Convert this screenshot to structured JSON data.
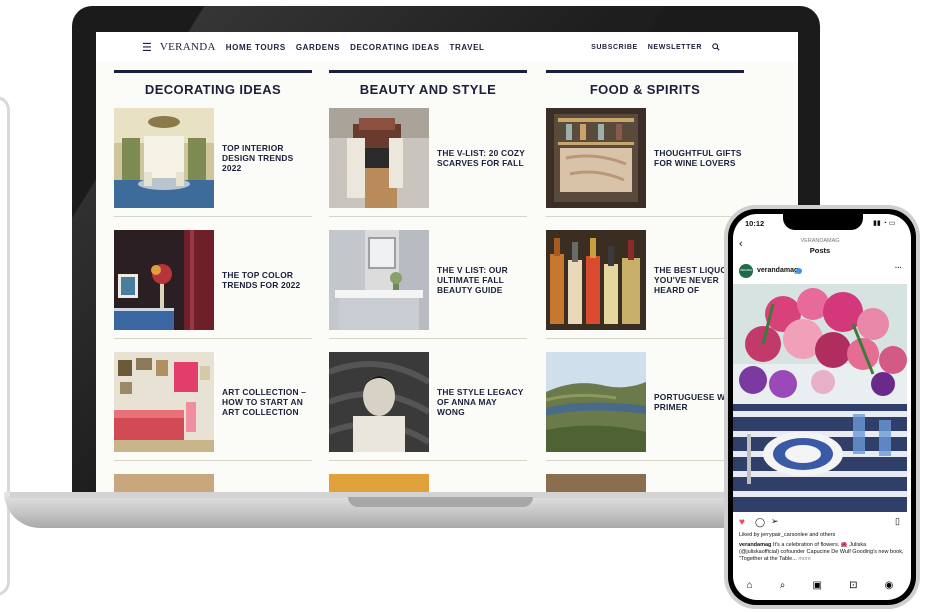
{
  "site": {
    "logo": "VERANDA",
    "nav_links": [
      "HOME TOURS",
      "GARDENS",
      "DECORATING IDEAS",
      "TRAVEL"
    ],
    "subscribe": "SUBSCRIBE",
    "newsletter": "NEWSLETTER"
  },
  "columns": [
    {
      "title": "DECORATING IDEAS",
      "items": [
        {
          "title": "TOP INTERIOR DESIGN TRENDS 2022"
        },
        {
          "title": "THE TOP COLOR TRENDS FOR 2022"
        },
        {
          "title": "ART COLLECTION – HOW TO START AN ART COLLECTION"
        }
      ]
    },
    {
      "title": "BEAUTY AND STYLE",
      "items": [
        {
          "title": "THE V-LIST: 20 COZY SCARVES FOR FALL"
        },
        {
          "title": "THE V LIST: OUR ULTIMATE FALL BEAUTY GUIDE"
        },
        {
          "title": "THE STYLE LEGACY OF ANNA MAY WONG"
        }
      ]
    },
    {
      "title": "FOOD & SPIRITS",
      "items": [
        {
          "title": "THOUGHTFUL GIFTS FOR WINE LOVERS"
        },
        {
          "title": "THE BEST LIQUOR YOU'VE NEVER HEARD OF"
        },
        {
          "title": "PORTUGUESE WI A PRIMER"
        }
      ]
    }
  ],
  "phone": {
    "time": "10:12",
    "header_account": "VERANDAMAG",
    "header_title": "Posts",
    "username": "verandamag",
    "liked_by": "Liked by jerrypair_carsonlee and others",
    "caption_user": "verandamag",
    "caption_text": "It's a celebration of flowers. 🌺 Juliska (@juliskaofficial) cofounder Capucine De Wulf Gooding's new book, \"Together at the Table...",
    "caption_more": "more",
    "avatar_text": "VERANDA"
  },
  "colors": {
    "navy": "#1b1f3b",
    "instagram_like": "#ed4956",
    "verified": "#3897f0"
  }
}
